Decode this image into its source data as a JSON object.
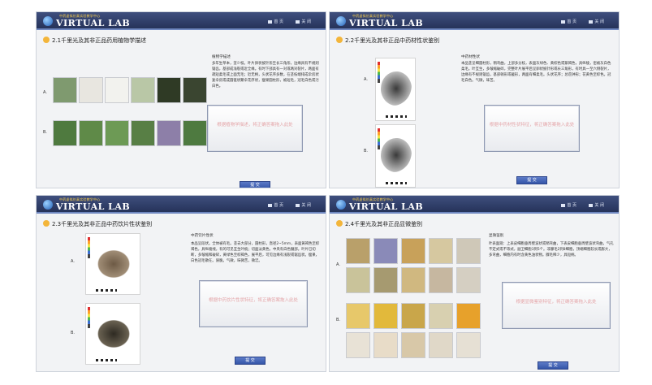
{
  "brand": {
    "logo_text": "VIRTUAL LAB",
    "logo_subtitle": "中药虚拟仿真实验教学中心",
    "nav_home": "首 页",
    "nav_close": "关 闭"
  },
  "panels": [
    {
      "title": "2.1千里光及其非正品药用植物学描述",
      "row_a": "A.",
      "row_b": "B.",
      "desc_header": "植物学描述",
      "desc_text": "多年生草本，茎少枝。叶片卵状披针形至长三角形，边缘具有不规则锯齿，基部成浅裂或近全缘。有时下部具有一对或两对裂片，两面有疏短柔毛或上面无毛；近无柄，头状花序多数，在茎枝端排成伞房状复伞房或成圆锥状聚伞花序状，瘦果圆柱形，被短毛，冠毛白色或污白色。",
      "answer_placeholder": "根据植物学描述，将正确答案拖入此处",
      "submit": "提 交"
    },
    {
      "title": "2.2千里光及其非正品中药材性状鉴别",
      "row_a": "A.",
      "row_b": "B.",
      "desc_header": "中药材性状",
      "desc_text": "本品茎呈细圆柱形，稍弯曲，上部多分枝，表面灰绿色、黄棕色或紫褐色，具纵棱，密被灰白色柔毛。叶互生，多皱缩破碎，完整叶片展平后呈卵状披针形或长三角形，有时具一至六侧裂片，边缘有不规则锯齿，基部戟形或截形，两面有细柔毛。头状花序；总苞钟形；花黄色至棕色。冠毛白色。气微，味苦。",
      "answer_placeholder": "根据中药材性状特征，将正确答案拖入此处",
      "submit": "提 交"
    },
    {
      "title": "2.3千里光及其非正品中药饮片性状鉴别",
      "row_a": "A.",
      "row_b": "B.",
      "desc_header": "中药饮片性状",
      "desc_text": "本品呈段状。全体被有毛。茎去大部分，圆柱形，直径2~5mm，表面黄褐色至棕褐色，具纵棱线，有的可见互生叶痕；切面淡黄色，中央有白色髓部。叶片已切断，多皱缩和破碎，黄绿色至棕褐色，展平后，可见边缘有浅裂或锯齿状。瘦果，白色冠毛散在。质脆。气微，味微苦，微涩。",
      "answer_placeholder": "根据中药饮片性状特征，将正确答案拖入此处",
      "submit": "提 交"
    },
    {
      "title": "2.4千里光及其非正品显微鉴别",
      "row_a": "A.",
      "row_b": "B.",
      "desc_header": "显微鉴别",
      "desc_text": "叶表面观：上表皮细胞垂周壁波状或稍弯曲，下表皮细胞垂周壁波状弯曲，气孔不定式或不等式，副卫细胞3到5个。非腺毛2到8细胞，顶端细胞较长或膨大，多弯曲，细胞内有时含黄色油状物。腺毛稀少，具短柄。",
      "answer_placeholder": "根据显微鉴别特征，将正确答案拖入此处",
      "submit": "提 交"
    }
  ],
  "thumb_colors": {
    "panel1_row_a": [
      "#7f9a6f",
      "#e8e6e0",
      "#f2f2ee",
      "#b9c7a6",
      "#2f3a25",
      "#3a4530"
    ],
    "panel1_row_b": [
      "#4f7a3f",
      "#5f8a48",
      "#6d9a55",
      "#587f45",
      "#8d7fa8",
      "#4e7a40"
    ],
    "panel4_row_a": [
      "#b9a06a",
      "#8a8ab8",
      "#c8a15a",
      "#d6c8a0",
      "#cfc8b8",
      "#c9c39a",
      "#a69a70",
      "#d0b880",
      "#c6b7a0",
      "#d5cfc2"
    ],
    "panel4_row_b": [
      "#e7c86a",
      "#e2b93b",
      "#c9a64a",
      "#d8d0b0",
      "#e7a12b",
      "#e8e2d6",
      "#e8dcc8",
      "#d8c8a8",
      "#e0d8c8",
      "#e6e0d4"
    ]
  }
}
